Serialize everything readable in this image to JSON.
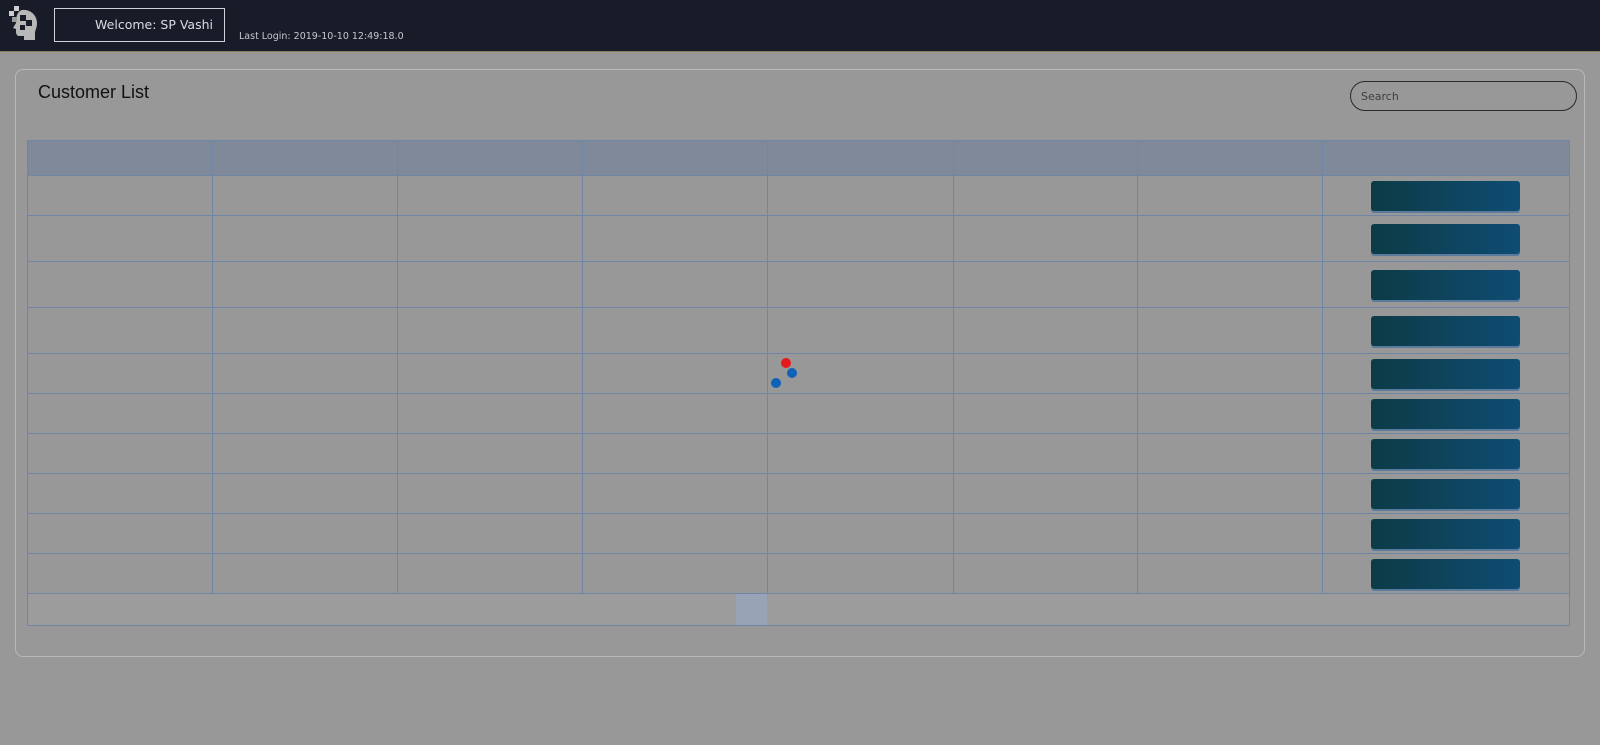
{
  "header": {
    "welcome_text": "Welcome: SP Vashi",
    "last_login_text": "Last Login: 2019-10-10 12:49:18.0",
    "logo_icon": "head-puzzle-logo-icon",
    "background_color": "#171c28"
  },
  "page": {
    "title": "Customer List"
  },
  "search": {
    "placeholder": "Search",
    "value": ""
  },
  "table": {
    "column_headers": [
      "",
      "",
      "",
      "",
      "",
      "",
      "",
      ""
    ],
    "rows": [
      {
        "cells": [
          "",
          "",
          "",
          "",
          "",
          "",
          ""
        ],
        "action_label": ""
      },
      {
        "cells": [
          "",
          "",
          "",
          "",
          "",
          "",
          ""
        ],
        "action_label": ""
      },
      {
        "cells": [
          "",
          "",
          "",
          "",
          "",
          "",
          ""
        ],
        "action_label": ""
      },
      {
        "cells": [
          "",
          "",
          "",
          "",
          "",
          "",
          ""
        ],
        "action_label": ""
      },
      {
        "cells": [
          "",
          "",
          "",
          "",
          "",
          "",
          ""
        ],
        "action_label": ""
      },
      {
        "cells": [
          "",
          "",
          "",
          "",
          "",
          "",
          ""
        ],
        "action_label": ""
      },
      {
        "cells": [
          "",
          "",
          "",
          "",
          "",
          "",
          ""
        ],
        "action_label": ""
      },
      {
        "cells": [
          "",
          "",
          "",
          "",
          "",
          "",
          ""
        ],
        "action_label": ""
      },
      {
        "cells": [
          "",
          "",
          "",
          "",
          "",
          "",
          ""
        ],
        "action_label": ""
      },
      {
        "cells": [
          "",
          "",
          "",
          "",
          "",
          "",
          ""
        ],
        "action_label": ""
      }
    ],
    "pager": {
      "current_page": ""
    },
    "header_color": "#7f8999",
    "button_gradient": [
      "#0c3b46",
      "#0f4c73"
    ]
  },
  "loading_indicator": {
    "visible": true,
    "dot_colors": [
      "#e51a1a",
      "#0e62b7",
      "#0e62b7"
    ]
  }
}
